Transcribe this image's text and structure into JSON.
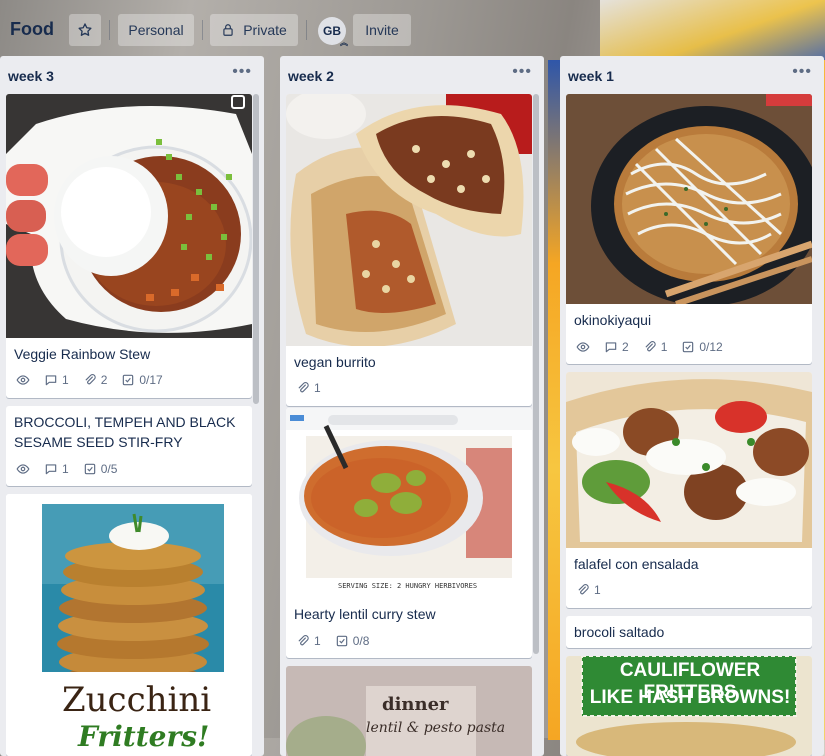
{
  "board": {
    "title": "Food",
    "star_label": "",
    "visibility_personal": "Personal",
    "visibility_private": "Private",
    "member_initials": "GB",
    "invite_label": "Invite"
  },
  "lists": [
    {
      "title": "week 3",
      "cards": [
        {
          "title": "Veggie Rainbow Stew",
          "comments": "1",
          "attachments": "2",
          "checklist": "0/17"
        },
        {
          "title": "BROCCOLI, TEMPEH AND BLACK SESAME SEED STIR-FRY",
          "comments": "1",
          "checklist": "0/5"
        },
        {
          "cover_text_1": "Zucchini",
          "cover_text_2": "Fritters!"
        }
      ]
    },
    {
      "title": "week 2",
      "cards": [
        {
          "title": "vegan burrito",
          "attachments": "1"
        },
        {
          "title": "Hearty lentil curry stew",
          "attachments": "1",
          "checklist": "0/8",
          "cover_caption": "SERVING SIZE: 2 HUNGRY HERBIVORES"
        },
        {
          "cover_text_1": "dinner",
          "cover_text_2": "lentil & pesto pasta"
        }
      ]
    },
    {
      "title": "week 1",
      "cards": [
        {
          "title": "okinokiyaqui",
          "comments": "2",
          "attachments": "1",
          "checklist": "0/12"
        },
        {
          "title": "falafel con ensalada",
          "attachments": "1"
        },
        {
          "title": "brocoli saltado"
        },
        {
          "cover_text_1": "CAULIFLOWER FRITTERS",
          "cover_text_2": "LIKE HASH BROWNS!"
        }
      ]
    }
  ]
}
